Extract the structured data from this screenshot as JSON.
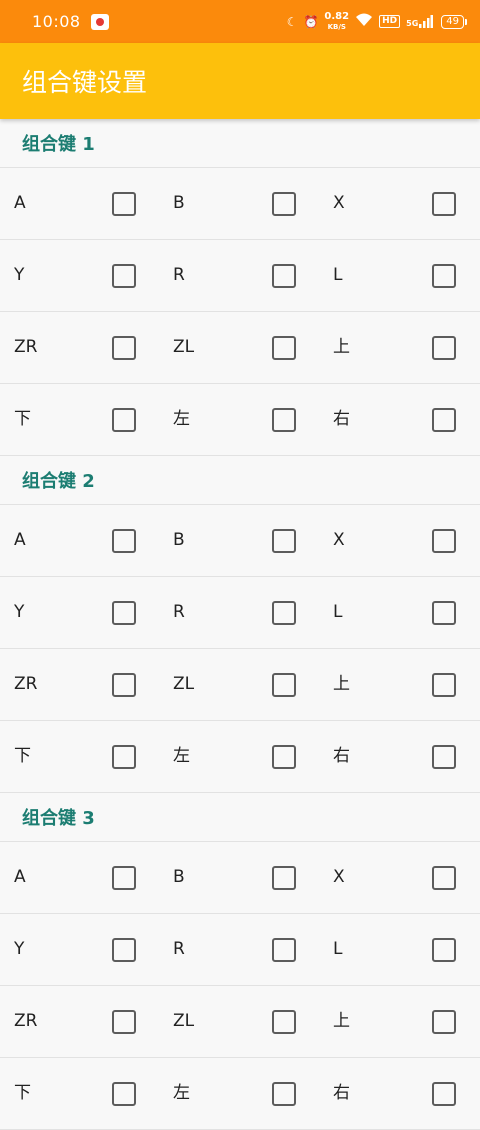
{
  "status_bar": {
    "time": "10:08",
    "network_speed_value": "0.82",
    "network_speed_unit": "KB/S",
    "hd": "HD",
    "signal": "5G",
    "battery": "49"
  },
  "app_bar": {
    "title": "组合键设置"
  },
  "groups": [
    {
      "title": "组合键 1",
      "rows": [
        [
          "A",
          "B",
          "X"
        ],
        [
          "Y",
          "R",
          "L"
        ],
        [
          "ZR",
          "ZL",
          "上"
        ],
        [
          "下",
          "左",
          "右"
        ]
      ]
    },
    {
      "title": "组合键 2",
      "rows": [
        [
          "A",
          "B",
          "X"
        ],
        [
          "Y",
          "R",
          "L"
        ],
        [
          "ZR",
          "ZL",
          "上"
        ],
        [
          "下",
          "左",
          "右"
        ]
      ]
    },
    {
      "title": "组合键 3",
      "rows": [
        [
          "A",
          "B",
          "X"
        ],
        [
          "Y",
          "R",
          "L"
        ],
        [
          "ZR",
          "ZL",
          "上"
        ],
        [
          "下",
          "左",
          "右"
        ]
      ]
    }
  ],
  "colors": {
    "status_bar_bg": "#fb8a0c",
    "app_bar_bg": "#fdc00c",
    "group_header_text": "#1c7d72",
    "checkbox_border": "#5c5c5c"
  }
}
